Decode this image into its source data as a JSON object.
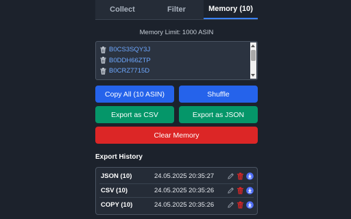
{
  "tabs": [
    {
      "label": "Collect"
    },
    {
      "label": "Filter"
    },
    {
      "label": "Memory (10)"
    }
  ],
  "memory_limit": "Memory Limit: 1000 ASIN",
  "asins": [
    "B0CS3SQY3J",
    "B0DDH66ZTP",
    "B0CRZ7715D"
  ],
  "buttons": {
    "copy_all": "Copy All (10 ASIN)",
    "shuffle": "Shuffle",
    "export_csv": "Export as CSV",
    "export_json": "Export as JSON",
    "clear_memory": "Clear Memory"
  },
  "history": {
    "title": "Export History",
    "rows": [
      {
        "type": "JSON (10)",
        "date": "24.05.2025 20:35:27"
      },
      {
        "type": "CSV (10)",
        "date": "24.05.2025 20:35:26"
      },
      {
        "type": "COPY (10)",
        "date": "24.05.2025 20:35:26"
      }
    ]
  },
  "colors": {
    "background": "#1c222c",
    "accent_blue": "#2563eb",
    "export_green": "#059669",
    "danger_red": "#dc2626",
    "asin_link": "#6ea8ff"
  },
  "icons": {
    "asin_delete": "trash-icon",
    "history_edit": "pencil-icon",
    "history_delete": "trash-icon",
    "history_download": "download-icon"
  }
}
